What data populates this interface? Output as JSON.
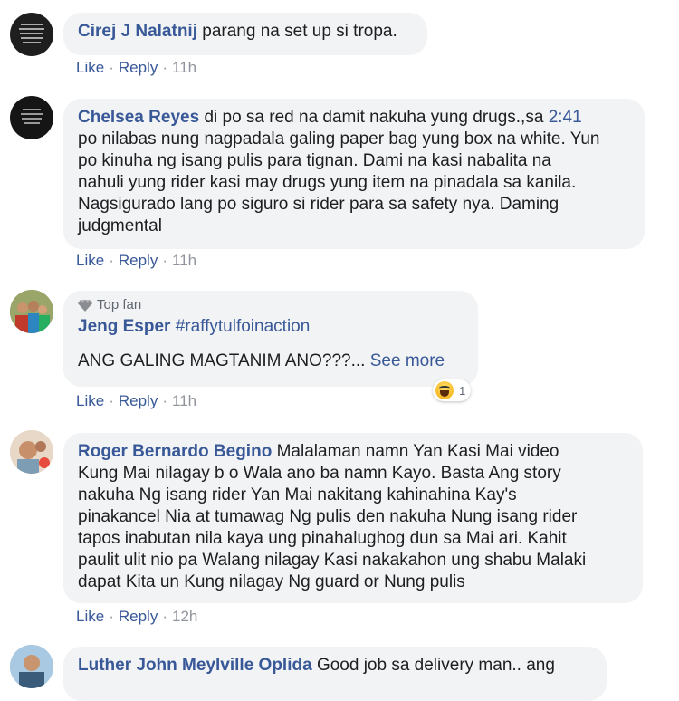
{
  "actions": {
    "like": "Like",
    "reply": "Reply",
    "separator": "·"
  },
  "comments": [
    {
      "name": "Cirej J Nalatnij",
      "text": "parang na set up si tropa.",
      "time": "11h",
      "avatar_icon": "text-image-avatar"
    },
    {
      "name": "Chelsea Reyes",
      "text_lines": [
        "di po sa red na damit nakuha yung drugs.,sa ",
        "po nilabas nung nagpadala galing paper bag yung box na white. Yun",
        "po kinuha ng isang pulis para tignan. Dami na kasi nabalita na",
        "nahuli yung rider kasi may drugs yung item na pinadala sa kanila.",
        "Nagsigurado lang po siguro si rider para sa safety nya. Daming",
        "judgmental"
      ],
      "timestamp_link": "2:41",
      "time": "11h",
      "avatar_icon": "text-image-avatar"
    },
    {
      "badge": "Top fan",
      "badge_icon": "diamond-icon",
      "name": "Jeng Esper",
      "hashtag": "#raffytulfoinaction",
      "text": "ANG GALING MAGTANIM ANO???...",
      "see_more": "See more",
      "reaction_icon": "haha-emoji-icon",
      "reaction_count": "1",
      "time": "11h",
      "avatar_icon": "family-photo-avatar"
    },
    {
      "name": "Roger Bernardo Begino",
      "text_lines": [
        "Malalaman namn Yan Kasi Mai video",
        "Kung Mai nilagay b o Wala ano ba namn Kayo. Basta Ang story",
        "nakuha Ng isang rider Yan Mai nakitang kahinahina Kay's",
        "pinakancel Nia at tumawag Ng pulis den nakuha Nung isang rider",
        "tapos inabutan nila kaya ung pinahalughog dun sa Mai ari. Kahit",
        "paulit ulit nio pa Walang nilagay Kasi nakakahon ung shabu Malaki",
        "dapat Kita un Kung nilagay Ng guard or Nung pulis"
      ],
      "time": "12h",
      "avatar_icon": "child-photo-avatar"
    },
    {
      "name": "Luther John Meylville Oplida",
      "text": "Good job sa delivery man.. ang",
      "avatar_icon": "person-photo-avatar"
    }
  ]
}
